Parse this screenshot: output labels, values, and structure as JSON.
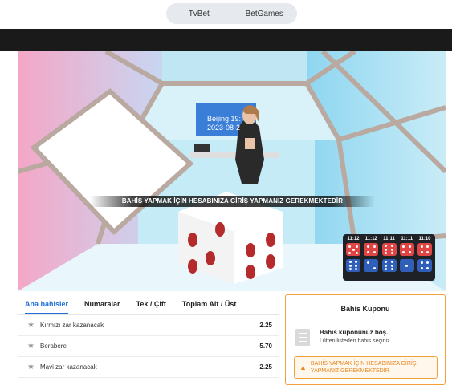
{
  "providers": {
    "tabs": [
      "TvBet",
      "BetGames"
    ]
  },
  "video": {
    "notice": "BAHİS YAPMAK İÇİN HESABINIZA GİRİŞ YAPMANIZ GEREKMEKTEDİR",
    "screen_line1": "Beijing 19:",
    "screen_line2": "2023-08-2",
    "results": {
      "times": [
        "11:12",
        "11:12",
        "11:11",
        "11:11",
        "11:10"
      ],
      "red_dice": [
        5,
        4,
        6,
        4,
        4
      ],
      "blue_dice": [
        6,
        2,
        6,
        1,
        4
      ]
    }
  },
  "bets": {
    "tabs": [
      "Ana bahisler",
      "Numaralar",
      "Tek / Çift",
      "Toplam Alt / Üst"
    ],
    "rows": [
      {
        "label": "Kırmızı zar kazanacak",
        "odd": "2.25"
      },
      {
        "label": "Berabere",
        "odd": "5.70"
      },
      {
        "label": "Mavi zar kazanacak",
        "odd": "2.25"
      }
    ]
  },
  "coupon": {
    "title": "Bahis Kuponu",
    "empty_title": "Bahis kuponunuz boş.",
    "empty_sub": "Lütfen listeden bahis seçiniz.",
    "warning": "BAHİS YAPMAK İÇİN HESABINIZA GİRİŞ YAPMANIZ GEREKMEKTEDİR"
  }
}
